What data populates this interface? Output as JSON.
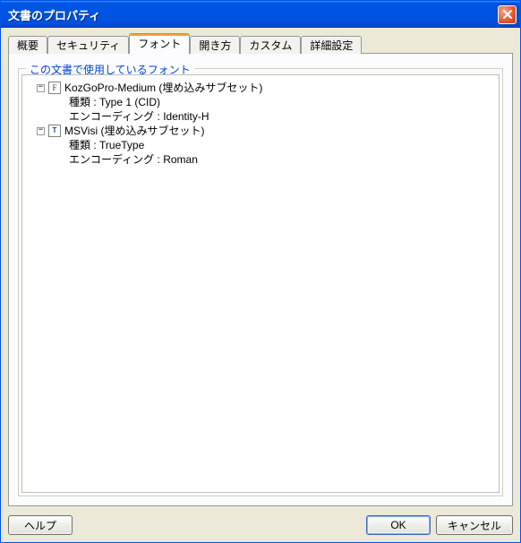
{
  "window": {
    "title": "文書のプロパティ"
  },
  "tabs": {
    "items": [
      {
        "label": "概要"
      },
      {
        "label": "セキュリティ"
      },
      {
        "label": "フォント"
      },
      {
        "label": "開き方"
      },
      {
        "label": "カスタム"
      },
      {
        "label": "詳細設定"
      }
    ],
    "active_index": 2
  },
  "group": {
    "label": "この文書で使用しているフォント"
  },
  "fonts": [
    {
      "expander": "−",
      "icon_letter": "F",
      "name": "KozGoPro-Medium (埋め込みサブセット)",
      "kind_label": "種類 :",
      "kind_value": "Type 1 (CID)",
      "enc_label": "エンコーディング :",
      "enc_value": "Identity-H"
    },
    {
      "expander": "−",
      "icon_letter": "T",
      "icon_variant": "tt",
      "name": "MSVisi (埋め込みサブセット)",
      "kind_label": "種類 :",
      "kind_value": "TrueType",
      "enc_label": "エンコーディング :",
      "enc_value": "Roman"
    }
  ],
  "buttons": {
    "help": "ヘルプ",
    "ok": "OK",
    "cancel": "キャンセル"
  }
}
